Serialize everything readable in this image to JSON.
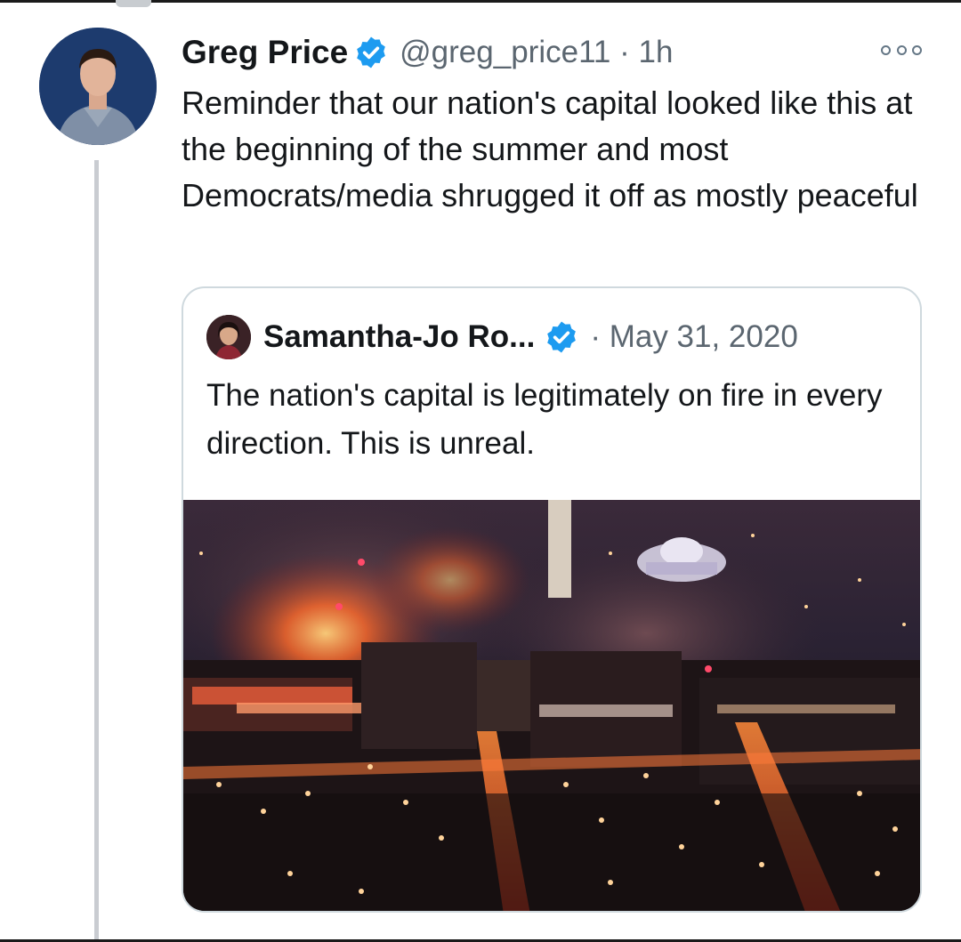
{
  "tweet": {
    "author_name": "Greg Price",
    "handle_time": "@greg_price11 · 1h",
    "text": "Reminder that our nation's capital looked like this at the beginning of the summer and most Democrats/media shrugged it off as mostly peaceful",
    "avatar_icon": "profile-photo",
    "verified_icon": "verified-badge-icon",
    "more_icon": "more-options-icon"
  },
  "quoted_tweet": {
    "author_name": "Samantha-Jo Ro...",
    "date": "· May 31, 2020",
    "text": "The nation's capital is legitimately on fire in every direction. This is unreal.",
    "verified_icon": "verified-badge-icon"
  },
  "colors": {
    "verified_blue": "#1d9bf0",
    "secondary_text": "#5b6670",
    "border": "#cfd9de",
    "thread_line": "#c9ccd1"
  }
}
